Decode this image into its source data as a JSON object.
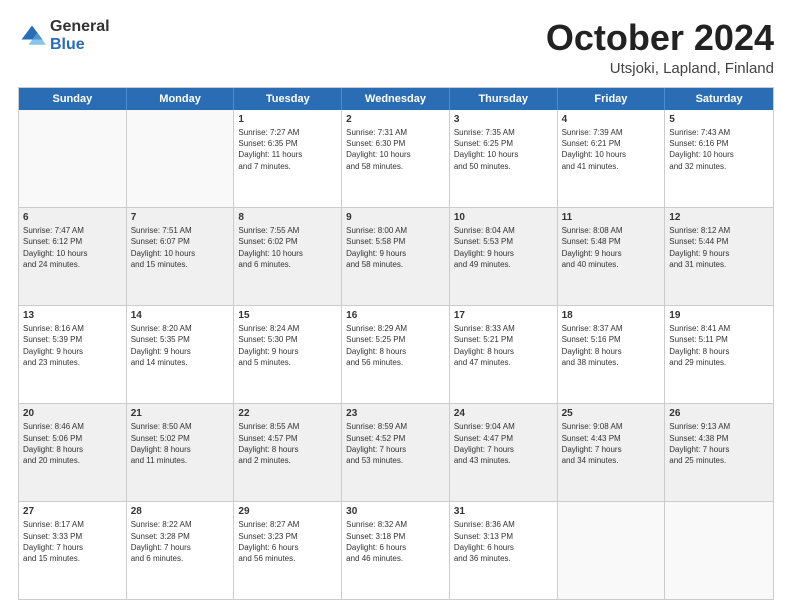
{
  "header": {
    "logo_line1": "General",
    "logo_line2": "Blue",
    "month": "October 2024",
    "location": "Utsjoki, Lapland, Finland"
  },
  "weekdays": [
    "Sunday",
    "Monday",
    "Tuesday",
    "Wednesday",
    "Thursday",
    "Friday",
    "Saturday"
  ],
  "rows": [
    [
      {
        "day": "",
        "lines": []
      },
      {
        "day": "",
        "lines": []
      },
      {
        "day": "1",
        "lines": [
          "Sunrise: 7:27 AM",
          "Sunset: 6:35 PM",
          "Daylight: 11 hours",
          "and 7 minutes."
        ]
      },
      {
        "day": "2",
        "lines": [
          "Sunrise: 7:31 AM",
          "Sunset: 6:30 PM",
          "Daylight: 10 hours",
          "and 58 minutes."
        ]
      },
      {
        "day": "3",
        "lines": [
          "Sunrise: 7:35 AM",
          "Sunset: 6:25 PM",
          "Daylight: 10 hours",
          "and 50 minutes."
        ]
      },
      {
        "day": "4",
        "lines": [
          "Sunrise: 7:39 AM",
          "Sunset: 6:21 PM",
          "Daylight: 10 hours",
          "and 41 minutes."
        ]
      },
      {
        "day": "5",
        "lines": [
          "Sunrise: 7:43 AM",
          "Sunset: 6:16 PM",
          "Daylight: 10 hours",
          "and 32 minutes."
        ]
      }
    ],
    [
      {
        "day": "6",
        "lines": [
          "Sunrise: 7:47 AM",
          "Sunset: 6:12 PM",
          "Daylight: 10 hours",
          "and 24 minutes."
        ]
      },
      {
        "day": "7",
        "lines": [
          "Sunrise: 7:51 AM",
          "Sunset: 6:07 PM",
          "Daylight: 10 hours",
          "and 15 minutes."
        ]
      },
      {
        "day": "8",
        "lines": [
          "Sunrise: 7:55 AM",
          "Sunset: 6:02 PM",
          "Daylight: 10 hours",
          "and 6 minutes."
        ]
      },
      {
        "day": "9",
        "lines": [
          "Sunrise: 8:00 AM",
          "Sunset: 5:58 PM",
          "Daylight: 9 hours",
          "and 58 minutes."
        ]
      },
      {
        "day": "10",
        "lines": [
          "Sunrise: 8:04 AM",
          "Sunset: 5:53 PM",
          "Daylight: 9 hours",
          "and 49 minutes."
        ]
      },
      {
        "day": "11",
        "lines": [
          "Sunrise: 8:08 AM",
          "Sunset: 5:48 PM",
          "Daylight: 9 hours",
          "and 40 minutes."
        ]
      },
      {
        "day": "12",
        "lines": [
          "Sunrise: 8:12 AM",
          "Sunset: 5:44 PM",
          "Daylight: 9 hours",
          "and 31 minutes."
        ]
      }
    ],
    [
      {
        "day": "13",
        "lines": [
          "Sunrise: 8:16 AM",
          "Sunset: 5:39 PM",
          "Daylight: 9 hours",
          "and 23 minutes."
        ]
      },
      {
        "day": "14",
        "lines": [
          "Sunrise: 8:20 AM",
          "Sunset: 5:35 PM",
          "Daylight: 9 hours",
          "and 14 minutes."
        ]
      },
      {
        "day": "15",
        "lines": [
          "Sunrise: 8:24 AM",
          "Sunset: 5:30 PM",
          "Daylight: 9 hours",
          "and 5 minutes."
        ]
      },
      {
        "day": "16",
        "lines": [
          "Sunrise: 8:29 AM",
          "Sunset: 5:25 PM",
          "Daylight: 8 hours",
          "and 56 minutes."
        ]
      },
      {
        "day": "17",
        "lines": [
          "Sunrise: 8:33 AM",
          "Sunset: 5:21 PM",
          "Daylight: 8 hours",
          "and 47 minutes."
        ]
      },
      {
        "day": "18",
        "lines": [
          "Sunrise: 8:37 AM",
          "Sunset: 5:16 PM",
          "Daylight: 8 hours",
          "and 38 minutes."
        ]
      },
      {
        "day": "19",
        "lines": [
          "Sunrise: 8:41 AM",
          "Sunset: 5:11 PM",
          "Daylight: 8 hours",
          "and 29 minutes."
        ]
      }
    ],
    [
      {
        "day": "20",
        "lines": [
          "Sunrise: 8:46 AM",
          "Sunset: 5:06 PM",
          "Daylight: 8 hours",
          "and 20 minutes."
        ]
      },
      {
        "day": "21",
        "lines": [
          "Sunrise: 8:50 AM",
          "Sunset: 5:02 PM",
          "Daylight: 8 hours",
          "and 11 minutes."
        ]
      },
      {
        "day": "22",
        "lines": [
          "Sunrise: 8:55 AM",
          "Sunset: 4:57 PM",
          "Daylight: 8 hours",
          "and 2 minutes."
        ]
      },
      {
        "day": "23",
        "lines": [
          "Sunrise: 8:59 AM",
          "Sunset: 4:52 PM",
          "Daylight: 7 hours",
          "and 53 minutes."
        ]
      },
      {
        "day": "24",
        "lines": [
          "Sunrise: 9:04 AM",
          "Sunset: 4:47 PM",
          "Daylight: 7 hours",
          "and 43 minutes."
        ]
      },
      {
        "day": "25",
        "lines": [
          "Sunrise: 9:08 AM",
          "Sunset: 4:43 PM",
          "Daylight: 7 hours",
          "and 34 minutes."
        ]
      },
      {
        "day": "26",
        "lines": [
          "Sunrise: 9:13 AM",
          "Sunset: 4:38 PM",
          "Daylight: 7 hours",
          "and 25 minutes."
        ]
      }
    ],
    [
      {
        "day": "27",
        "lines": [
          "Sunrise: 8:17 AM",
          "Sunset: 3:33 PM",
          "Daylight: 7 hours",
          "and 15 minutes."
        ]
      },
      {
        "day": "28",
        "lines": [
          "Sunrise: 8:22 AM",
          "Sunset: 3:28 PM",
          "Daylight: 7 hours",
          "and 6 minutes."
        ]
      },
      {
        "day": "29",
        "lines": [
          "Sunrise: 8:27 AM",
          "Sunset: 3:23 PM",
          "Daylight: 6 hours",
          "and 56 minutes."
        ]
      },
      {
        "day": "30",
        "lines": [
          "Sunrise: 8:32 AM",
          "Sunset: 3:18 PM",
          "Daylight: 6 hours",
          "and 46 minutes."
        ]
      },
      {
        "day": "31",
        "lines": [
          "Sunrise: 8:36 AM",
          "Sunset: 3:13 PM",
          "Daylight: 6 hours",
          "and 36 minutes."
        ]
      },
      {
        "day": "",
        "lines": []
      },
      {
        "day": "",
        "lines": []
      }
    ]
  ]
}
